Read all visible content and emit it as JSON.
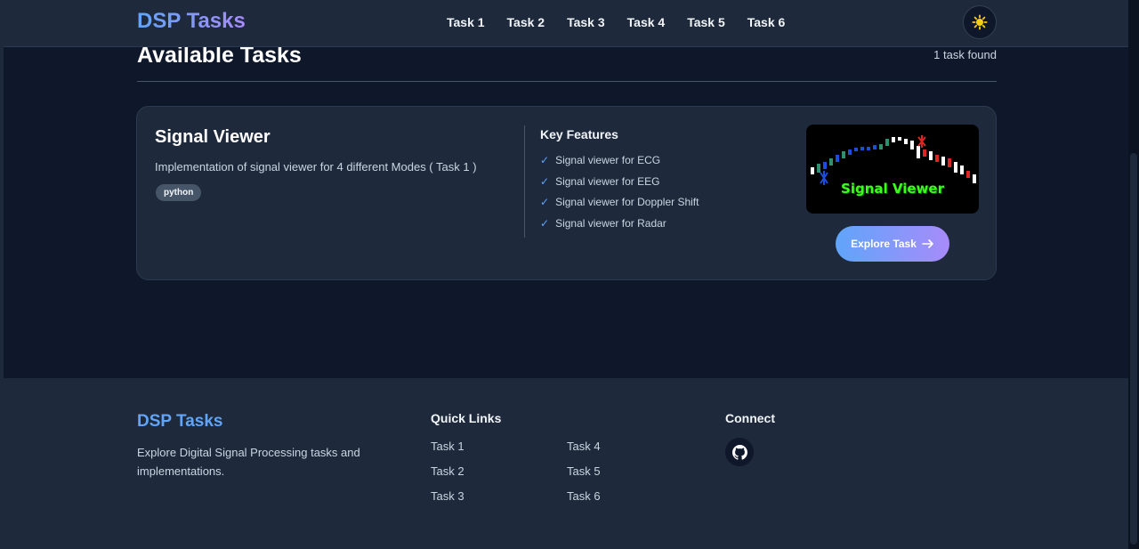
{
  "header": {
    "brand": "DSP Tasks",
    "nav": [
      "Task 1",
      "Task 2",
      "Task 3",
      "Task 4",
      "Task 5",
      "Task 6"
    ],
    "theme_icon": "sun-icon"
  },
  "main": {
    "title": "Available Tasks",
    "count": "1 task found",
    "cards": [
      {
        "title": "Signal Viewer",
        "description": "Implementation of signal viewer for 4 different Modes ( Task 1 )",
        "tag": "python",
        "features_title": "Key Features",
        "features": [
          "Signal viewer for ECG",
          "Signal viewer for EEG",
          "Signal viewer for Doppler Shift",
          "Signal viewer for Radar"
        ],
        "image_text": "Signal Viewer",
        "button": "Explore Task",
        "button_icon": "arrow-right-icon"
      }
    ]
  },
  "footer": {
    "brand": "DSP Tasks",
    "description": "Explore Digital Signal Processing tasks and implementations.",
    "quick_links_title": "Quick Links",
    "quick_links": [
      "Task 1",
      "Task 4",
      "Task 2",
      "Task 5",
      "Task 3",
      "Task 6"
    ],
    "connect_title": "Connect",
    "connect_icon": "github-icon"
  },
  "colors": {
    "background": "#0f172a",
    "surface": "#1e293b",
    "accent_start": "#60a5fa",
    "accent_end": "#a78bfa"
  }
}
